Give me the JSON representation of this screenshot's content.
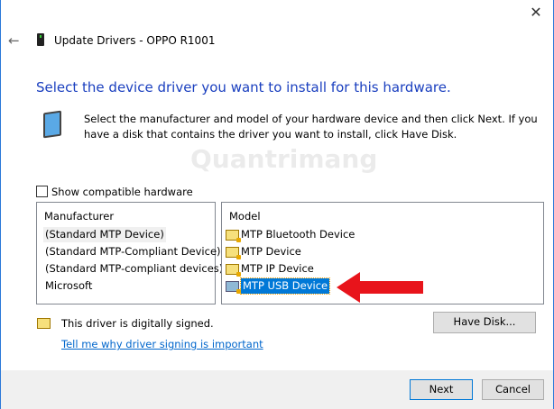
{
  "window": {
    "title": "Update Drivers - OPPO R1001",
    "close": "✕",
    "back": "←"
  },
  "heading": "Select the device driver you want to install for this hardware.",
  "description": "Select the manufacturer and model of your hardware device and then click Next. If you have a disk that contains the driver you want to install, click Have Disk.",
  "show_compatible": {
    "label": "Show compatible hardware",
    "checked": false
  },
  "manufacturer": {
    "header": "Manufacturer",
    "items": [
      "(Standard MTP Device)",
      "(Standard MTP-Compliant Device)",
      "(Standard MTP-compliant devices)",
      "Microsoft"
    ],
    "selected": 0
  },
  "model": {
    "header": "Model",
    "items": [
      "MTP Bluetooth Device",
      "MTP Device",
      "MTP IP Device",
      "MTP USB Device"
    ],
    "selected": 3
  },
  "signed_text": "This driver is digitally signed.",
  "signing_link": "Tell me why driver signing is important",
  "buttons": {
    "have_disk": "Have Disk...",
    "next": "Next",
    "cancel": "Cancel"
  },
  "watermark": "Quantrimang",
  "colors": {
    "heading": "#1a3fbf",
    "selection": "#0078d7",
    "arrow": "#e8141b"
  }
}
